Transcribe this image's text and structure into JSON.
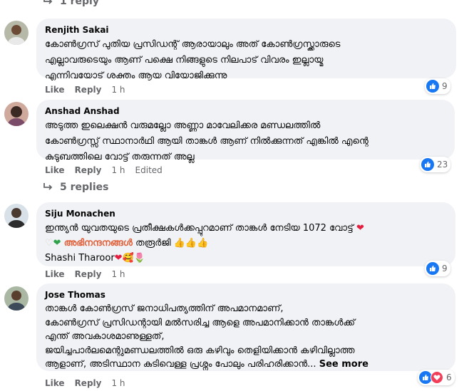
{
  "top_replies": {
    "label": "1 reply"
  },
  "comments": [
    {
      "author": "Renjith Sakai",
      "lines": [
        "കോൺഗ്രസ് പുതിയ പ്രസിഡന്റ് ആരായാലും അത് കോൺഗ്രസ്ക്കാരുടെ",
        "എല്ലാവരുടെയും ആണ് പക്ഷെ നിങ്ങളുടെ നിലപാട് വിവരം ഇല്ലായ്മ",
        "എന്നിവയോട് ശക്തം ആയ വിയോജിക്കുന്നു"
      ],
      "like": "Like",
      "reply": "Reply",
      "time": "1 h",
      "reaction_count": "9"
    },
    {
      "author": "Anshad Anshad",
      "lines": [
        "അടുത്ത ഇലെക്ഷൻ വരുമല്ലോ അണ്ണാ മാവേലിക്കര മണ്ഡലത്തിൽ",
        "കോൺഗ്രസ്സ് സ്ഥാനാർഥി ആയി താങ്കൾ ആണ് നിൽക്കുന്നത് എങ്കിൽ എന്റെ",
        "കുടുബത്തിലെ വോട്ട് തരുന്നത് അല്ല"
      ],
      "like": "Like",
      "reply": "Reply",
      "time": "1 h",
      "edited": "Edited",
      "reaction_count": "23",
      "replies_label": "5 replies"
    },
    {
      "author": "Siju Monachen",
      "line1": "ഇന്ത്യൻ യുവതയുടെ പ്രതീക്ഷകൾക്കപ്പുറമാണ് താങ്കൾ നേടിയ 1072 വോട്ട്",
      "line2_highlight": "അഭിനന്ദനങ്ങൾ",
      "line2_rest": "തരൂർജി 👍👍👍",
      "line3": "Shashi Tharoor",
      "line3_emoji": "🥰🌷",
      "like": "Like",
      "reply": "Reply",
      "time": "1 h",
      "reaction_count": "9"
    },
    {
      "author": "Jose Thomas",
      "lines": [
        "താങ്കൾ കോൺഗ്രസ് ജനാധിപത്യത്തിന് അപമാനമാണ്,",
        "കോൺഗ്രസ് പ്രസിഡന്റായി മൽസരിച്ച ആളെ അപമാനിക്കാൻ താങ്കൾക്ക്",
        "എന്ത് അവകാശമാണുള്ളത്,",
        "ജയിച്ചപാർലമെന്റുമണ്ഡലത്തിൽ ഒരു കഴിവും തെളിയിക്കാൻ കഴിവില്ലാത്ത"
      ],
      "last_line": "ആളാണ്, അടിസ്ഥാന കുടിവെള്ള പ്രശ്നം പോലും പരിഹരിക്കാൻ...",
      "see_more": "See more",
      "like": "Like",
      "reply": "Reply",
      "time": "1 h",
      "reaction_count": "6"
    }
  ],
  "colors": {
    "bubble": "#f0f2f5",
    "meta": "#65676b",
    "like_blue": "#1877f2",
    "love_red": "#f33e58",
    "highlight": "#e0603a"
  }
}
